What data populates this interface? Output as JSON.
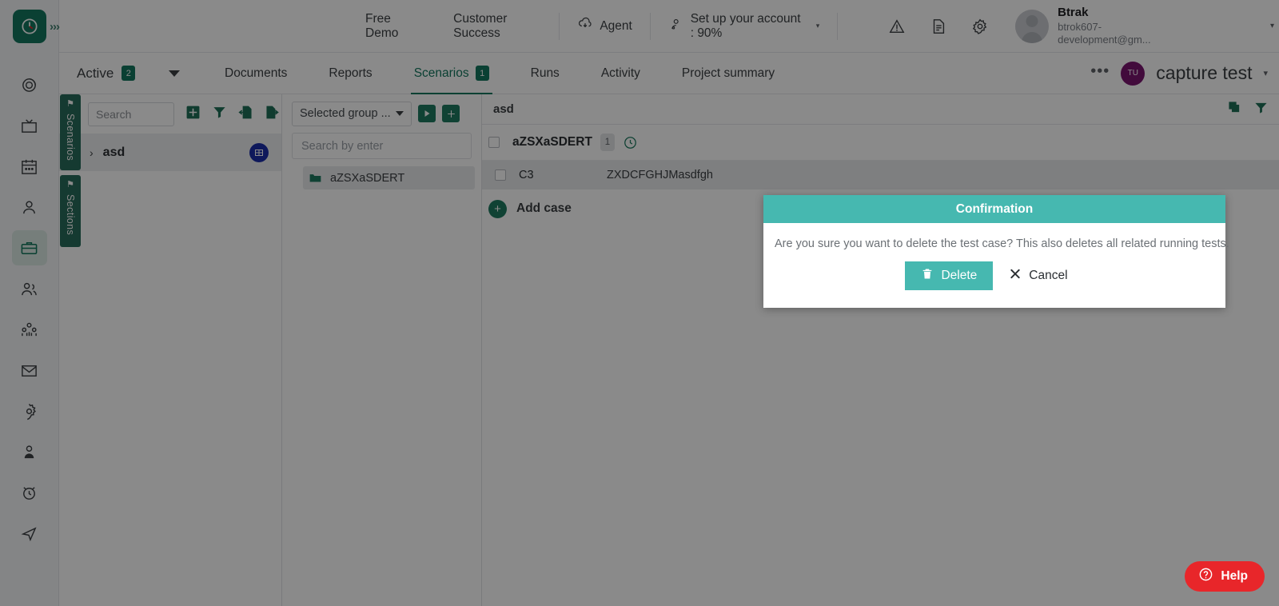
{
  "colors": {
    "brand_green": "#14775e",
    "teal": "#46b8b0",
    "badge_blue": "#1a2ea8",
    "project_avatar": "#7b1570",
    "help_red": "#e8262a"
  },
  "rail": {
    "logo_icon": "clock-target-logo-icon",
    "expand_icon": "double-chevron-right-icon",
    "items": [
      {
        "name": "sidebar-item-dashboard",
        "icon": "spiral-target-icon",
        "active": false
      },
      {
        "name": "sidebar-item-tv",
        "icon": "tv-screen-icon",
        "active": false
      },
      {
        "name": "sidebar-item-calendar",
        "icon": "calendar-icon",
        "active": false
      },
      {
        "name": "sidebar-item-user",
        "icon": "user-icon",
        "active": false
      },
      {
        "name": "sidebar-item-projects",
        "icon": "briefcase-icon",
        "active": true
      },
      {
        "name": "sidebar-item-team",
        "icon": "two-users-icon",
        "active": false
      },
      {
        "name": "sidebar-item-org",
        "icon": "org-group-icon",
        "active": false
      },
      {
        "name": "sidebar-item-mail",
        "icon": "envelope-icon",
        "active": false
      },
      {
        "name": "sidebar-item-settings",
        "icon": "gear-icon",
        "active": false
      },
      {
        "name": "sidebar-item-contact",
        "icon": "contact-person-icon",
        "active": false
      },
      {
        "name": "sidebar-item-timer",
        "icon": "alarm-clock-icon",
        "active": false
      },
      {
        "name": "sidebar-item-send",
        "icon": "paper-plane-icon",
        "active": false
      }
    ]
  },
  "header": {
    "links": [
      {
        "label": "Free Demo",
        "icon": null
      },
      {
        "label": "Customer Success",
        "icon": null
      },
      {
        "label": "Agent",
        "icon": "cloud-download-icon"
      },
      {
        "label": "Set up your account : 90%",
        "icon": "user-setup-icon",
        "caret": "▾"
      }
    ],
    "icons": [
      {
        "name": "warning-icon"
      },
      {
        "name": "document-icon"
      },
      {
        "name": "gear-icon"
      }
    ],
    "profile": {
      "name": "Btrak",
      "email": "btrok607-development@gm...",
      "caret": "▾"
    }
  },
  "tabsrow": {
    "status_filter": {
      "label": "Active",
      "count": "2"
    },
    "tabs": [
      {
        "label": "Documents",
        "badge": null,
        "selected": false
      },
      {
        "label": "Reports",
        "badge": null,
        "selected": false
      },
      {
        "label": "Scenarios",
        "badge": "1",
        "selected": true
      },
      {
        "label": "Runs",
        "badge": null,
        "selected": false
      },
      {
        "label": "Activity",
        "badge": null,
        "selected": false
      },
      {
        "label": "Project summary",
        "badge": null,
        "selected": false
      }
    ],
    "more_label": "•••",
    "project": {
      "initials": "TU",
      "name": "capture test",
      "caret": "▾"
    }
  },
  "vtabs": [
    {
      "label": "Scenarios",
      "pin": "⚑"
    },
    {
      "label": "Sections",
      "pin": "⚑"
    }
  ],
  "panel1": {
    "search_placeholder": "Search",
    "icons": [
      {
        "name": "add-square-icon"
      },
      {
        "name": "filter-icon"
      },
      {
        "name": "import-icon"
      },
      {
        "name": "export-icon"
      }
    ],
    "tree": [
      {
        "caret": "›",
        "name": "asd",
        "badge_icon": "grid-badge-icon"
      }
    ]
  },
  "panel2": {
    "group_select_label": "Selected group ...",
    "run_icon": "play-icon",
    "add_icon": "add-square-icon",
    "search_placeholder": "Search by enter",
    "items": [
      {
        "label": "aZSXaSDERT",
        "icon": "folder-icon"
      }
    ]
  },
  "panel3": {
    "title": "asd",
    "head_icons": [
      {
        "name": "copy-icon"
      },
      {
        "name": "filter-icon"
      }
    ],
    "section": {
      "name": "aZSXaSDERT",
      "count": "1",
      "history_icon": "clock-history-icon"
    },
    "cases": [
      {
        "id": "C3",
        "title": "ZXDCFGHJMasdfgh"
      }
    ],
    "add_case_label": "Add case",
    "add_case_icon": "plus-circle-icon"
  },
  "modal": {
    "title": "Confirmation",
    "message": "Are you sure you want to delete the test case? This also deletes all related running tests.",
    "delete_label": "Delete",
    "delete_icon": "trash-icon",
    "cancel_label": "Cancel",
    "cancel_icon": "close-x-icon"
  },
  "help": {
    "label": "Help",
    "icon": "question-circle-icon"
  }
}
